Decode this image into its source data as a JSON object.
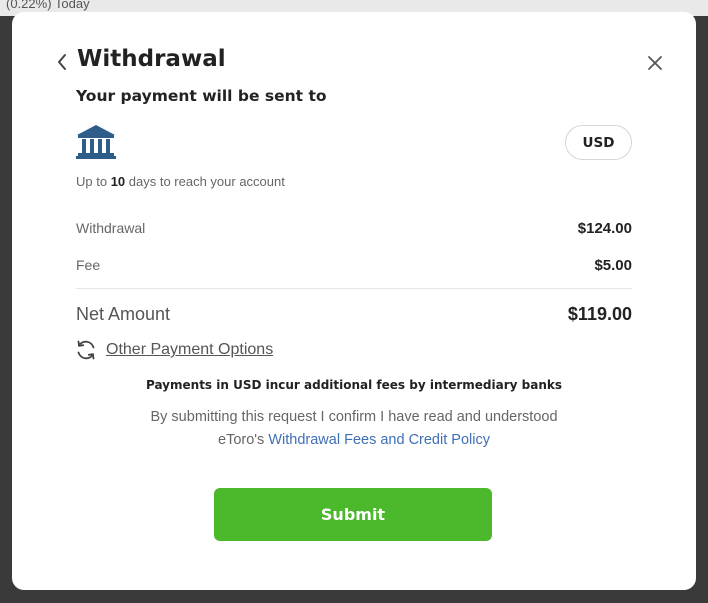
{
  "background": {
    "partial_text": "(0.22%) Today"
  },
  "modal": {
    "title": "Withdrawal",
    "subtitle": "Your payment will be sent to",
    "currency": "USD",
    "eta": {
      "prefix": "Up to ",
      "days": "10",
      "suffix": " days to reach your account"
    },
    "rows": [
      {
        "label": "Withdrawal",
        "value": "$124.00"
      },
      {
        "label": "Fee",
        "value": "$5.00"
      }
    ],
    "net": {
      "label": "Net Amount",
      "value": "$119.00"
    },
    "other_options_label": "Other Payment Options",
    "fees_note": "Payments in USD incur additional fees by intermediary banks",
    "confirm": {
      "line1": "By submitting this request I confirm I have read and understood",
      "line2_prefix": "eToro's ",
      "link_text": "Withdrawal Fees and Credit Policy"
    },
    "submit_label": "Submit"
  },
  "colors": {
    "accent_green": "#4bb92b",
    "link_blue": "#3f6fb5",
    "bank_icon": "#2f5d8a"
  },
  "icons": {
    "back": "chevron-left-icon",
    "close": "close-icon",
    "bank": "bank-icon",
    "refresh": "refresh-icon"
  }
}
